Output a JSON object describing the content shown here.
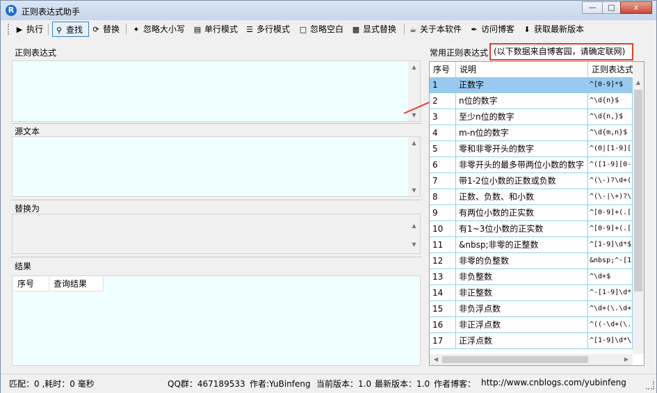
{
  "window": {
    "title": "正则表达式助手",
    "app_icon_letter": "R",
    "minimize": "—",
    "maximize": "□",
    "close": "x"
  },
  "toolbar": {
    "execute": "执行",
    "find": "查找",
    "replace": "替换",
    "ignore_case": "忽略大小写",
    "single_line": "单行模式",
    "multi_line": "多行模式",
    "ignore_whitespace": "忽略空白",
    "explicit_replace": "显式替换",
    "about": "关于本软件",
    "visit_blog": "访问博客",
    "get_latest": "获取最新版本"
  },
  "sections": {
    "regex": "正则表达式",
    "source": "源文本",
    "replace_with": "替换为",
    "result": "结果"
  },
  "result_table": {
    "columns": [
      "序号",
      "查询结果"
    ]
  },
  "common": {
    "label": "常用正则表达式",
    "note": "(以下数据来自博客园，请确定联网)",
    "columns": [
      "序号",
      "说明",
      "正则表达式"
    ],
    "rows": [
      {
        "no": "1",
        "desc": "正数字",
        "regex": "^[0-9]*$"
      },
      {
        "no": "2",
        "desc": "n位的数字",
        "regex": "^\\d{n}$"
      },
      {
        "no": "3",
        "desc": "至少n位的数字",
        "regex": "^\\d{n,}$"
      },
      {
        "no": "4",
        "desc": "m-n位的数字",
        "regex": "^\\d{m,n}$"
      },
      {
        "no": "5",
        "desc": "零和非零开头的数字",
        "regex": "^(0|[1-9][0"
      },
      {
        "no": "6",
        "desc": "非零开头的最多带两位小数的数字",
        "regex": "^([1-9][0-9"
      },
      {
        "no": "7",
        "desc": "带1-2位小数的正数或负数",
        "regex": "^(\\-)?\\d+(\\"
      },
      {
        "no": "8",
        "desc": "正数、负数、和小数",
        "regex": "^(\\-|\\+)?\\c"
      },
      {
        "no": "9",
        "desc": "有两位小数的正实数",
        "regex": "^[0-9]+(.[0"
      },
      {
        "no": "10",
        "desc": "有1~3位小数的正实数",
        "regex": "^[0-9]+(.[0"
      },
      {
        "no": "11",
        "desc": "&nbsp;非零的正整数",
        "regex": "^[1-9]\\d*$"
      },
      {
        "no": "12",
        "desc": "非零的负整数",
        "regex": "&nbsp;^-[1-"
      },
      {
        "no": "13",
        "desc": "非负整数",
        "regex": "^\\d+$"
      },
      {
        "no": "14",
        "desc": "非正整数",
        "regex": "^-[1-9]\\d*"
      },
      {
        "no": "15",
        "desc": "非负浮点数",
        "regex": "^\\d+(\\.\\d+)"
      },
      {
        "no": "16",
        "desc": "非正浮点数",
        "regex": "^((-\\d+(\\.\\"
      },
      {
        "no": "17",
        "desc": "正浮点数",
        "regex": "^[1-9]\\d*\\."
      }
    ]
  },
  "status": {
    "match": "匹配：0 ,耗时：0 毫秒",
    "qq": "QQ群：467189533",
    "author": "作者:YuBinfeng",
    "current_version": "当前版本：1.0",
    "latest_version": "最新版本：1.0",
    "author_blog_label": "作者博客：",
    "blog_url": "http://www.cnblogs.com/yubinfeng"
  },
  "colors": {
    "accent": "#99c9ef",
    "textbox_bg": "#f0ffff",
    "highlight": "#e83a2e"
  }
}
